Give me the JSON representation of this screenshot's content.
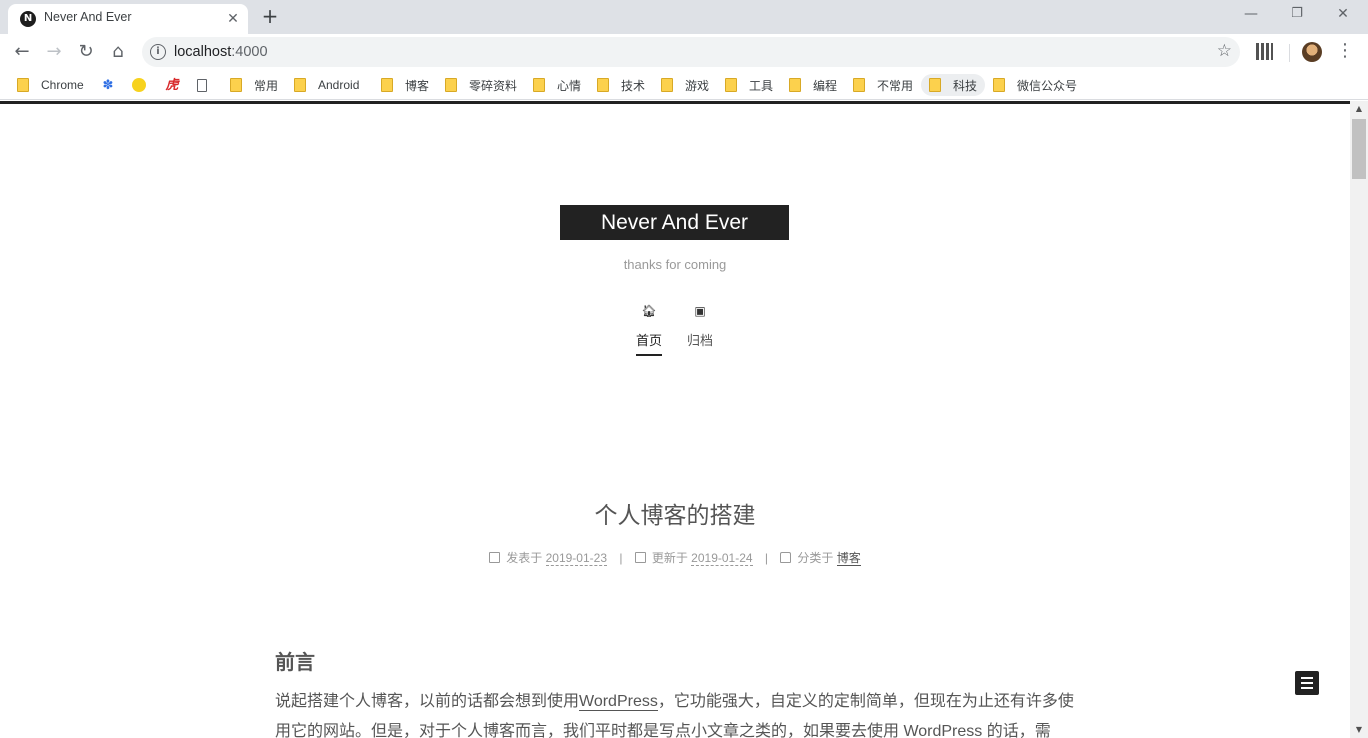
{
  "browser": {
    "tab": {
      "title": "Never And Ever",
      "favicon": "N"
    },
    "window_controls": {
      "minimize": "—",
      "restore": "❐",
      "close": "✕"
    },
    "url": {
      "host": "localhost",
      "port": ":4000"
    },
    "bookmarks": [
      {
        "label": "Chrome",
        "icon": "folder-icon"
      },
      {
        "label": "",
        "icon": "baidu-paw-icon"
      },
      {
        "label": "",
        "icon": "chick-icon"
      },
      {
        "label": "",
        "icon": "tiger-icon"
      },
      {
        "label": "",
        "icon": "page-icon"
      },
      {
        "label": "常用",
        "icon": "folder-icon"
      },
      {
        "label": "Android",
        "icon": "folder-icon"
      },
      {
        "label": "博客",
        "icon": "folder-icon"
      },
      {
        "label": "零碎资料",
        "icon": "folder-icon"
      },
      {
        "label": "心情",
        "icon": "folder-icon"
      },
      {
        "label": "技术",
        "icon": "folder-icon"
      },
      {
        "label": "游戏",
        "icon": "folder-icon"
      },
      {
        "label": "工具",
        "icon": "folder-icon"
      },
      {
        "label": "编程",
        "icon": "folder-icon"
      },
      {
        "label": "不常用",
        "icon": "folder-icon"
      },
      {
        "label": "科技",
        "icon": "folder-icon"
      },
      {
        "label": "微信公众号",
        "icon": "folder-icon"
      }
    ]
  },
  "site": {
    "title": "Never And Ever",
    "subtitle": "thanks for coming",
    "menu": [
      {
        "label": "首页",
        "icon": "home-icon",
        "active": true
      },
      {
        "label": "归档",
        "icon": "archive-icon",
        "active": false
      }
    ]
  },
  "post": {
    "title": "个人博客的搭建",
    "meta": {
      "posted_label": "发表于",
      "posted_date": "2019-01-23",
      "updated_label": "更新于",
      "updated_date": "2019-01-24",
      "category_label": "分类于",
      "category": "博客",
      "separator": "|"
    },
    "section_heading": "前言",
    "paragraph": {
      "part1": "说起搭建个人博客，以前的话都会想到使用",
      "link": "WordPress",
      "part2": "，它功能强大，自定义的定制简单，但现在为止还有许多使用它的网站。但是，对于个人博客而言，我们平时都是写点小文章之类的，如果要去使用 WordPress 的话，需"
    }
  }
}
